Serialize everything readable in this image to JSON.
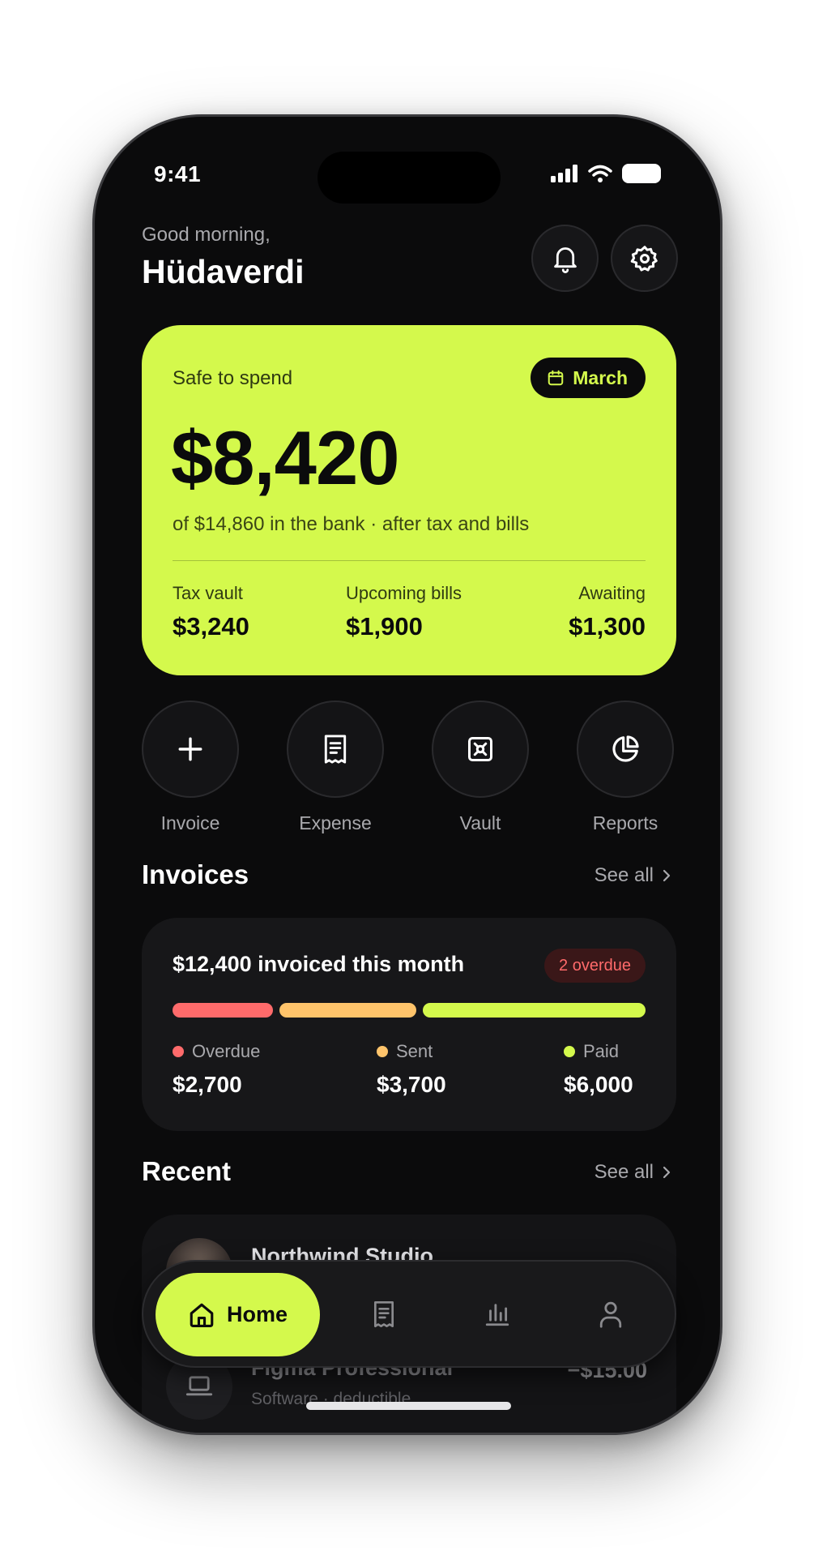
{
  "status": {
    "time": "9:41"
  },
  "header": {
    "greeting": "Good morning,",
    "name": "Hüdaverdi",
    "icons": [
      "bell-icon",
      "gear-icon"
    ]
  },
  "hero": {
    "label": "Safe to spend",
    "month": "March",
    "amount": "$8,420",
    "subtitle": "of $14,860 in the bank · after tax and bills",
    "stats": [
      {
        "label": "Tax vault",
        "value": "$3,240"
      },
      {
        "label": "Upcoming bills",
        "value": "$1,900"
      },
      {
        "label": "Awaiting",
        "value": "$1,300"
      }
    ]
  },
  "actions": [
    {
      "label": "Invoice",
      "icon": "plus-icon"
    },
    {
      "label": "Expense",
      "icon": "receipt-icon"
    },
    {
      "label": "Vault",
      "icon": "vault-icon"
    },
    {
      "label": "Reports",
      "icon": "pie-chart-icon"
    }
  ],
  "invoices": {
    "title": "Invoices",
    "see_all": "See all",
    "summary": "$12,400 invoiced this month",
    "badge": "2 overdue",
    "breakdown": [
      {
        "label": "Overdue",
        "value": "$2,700",
        "amount": 2700,
        "color": "#ff6b6b"
      },
      {
        "label": "Sent",
        "value": "$3,700",
        "amount": 3700,
        "color": "#ffc46b"
      },
      {
        "label": "Paid",
        "value": "$6,000",
        "amount": 6000,
        "color": "#d4f94c"
      }
    ]
  },
  "recent": {
    "title": "Recent",
    "see_all": "See all",
    "items": [
      {
        "name": "Northwind Studio"
      },
      {
        "name": "Figma Professional",
        "sub": "Software · deductible",
        "amount": "−$15.00"
      }
    ]
  },
  "tabbar": {
    "home_label": "Home"
  },
  "colors": {
    "accent": "#d4f94c",
    "background": "#0b0b0c",
    "overdue": "#ff6b6b",
    "sent": "#ffc46b"
  }
}
